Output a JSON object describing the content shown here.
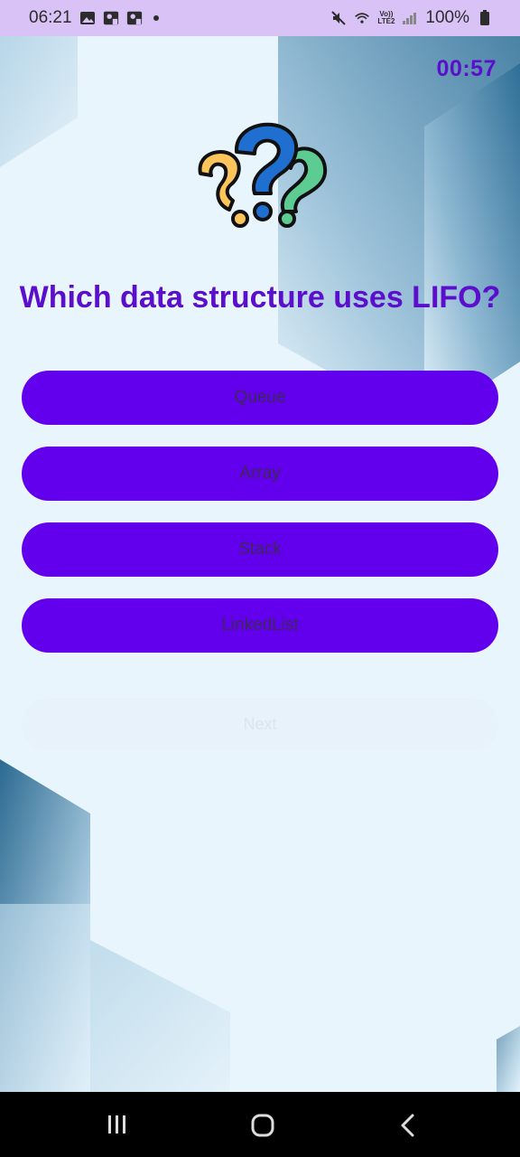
{
  "status_bar": {
    "time": "06:21",
    "battery": "100%",
    "network": "LTE2",
    "network_prefix": "Vo))",
    "icons": [
      "gallery-icon",
      "facebook-icon",
      "facebook-icon",
      "notification-dot",
      "mute-icon",
      "wifi-icon",
      "signal-icon",
      "battery-icon"
    ]
  },
  "quiz": {
    "timer": "00:57",
    "question": "Which data structure uses LIFO?",
    "options": [
      {
        "label": "Queue"
      },
      {
        "label": "Array"
      },
      {
        "label": "Stack"
      },
      {
        "label": "LinkedList"
      }
    ],
    "next_label": "Next"
  },
  "colors": {
    "accent": "#6200ee",
    "title": "#5b0ecb",
    "background": "#e8f5fc",
    "status_bar": "#d9c2f5"
  },
  "nav_bar": {
    "icons": [
      "recent-apps-icon",
      "home-icon",
      "back-icon"
    ]
  }
}
